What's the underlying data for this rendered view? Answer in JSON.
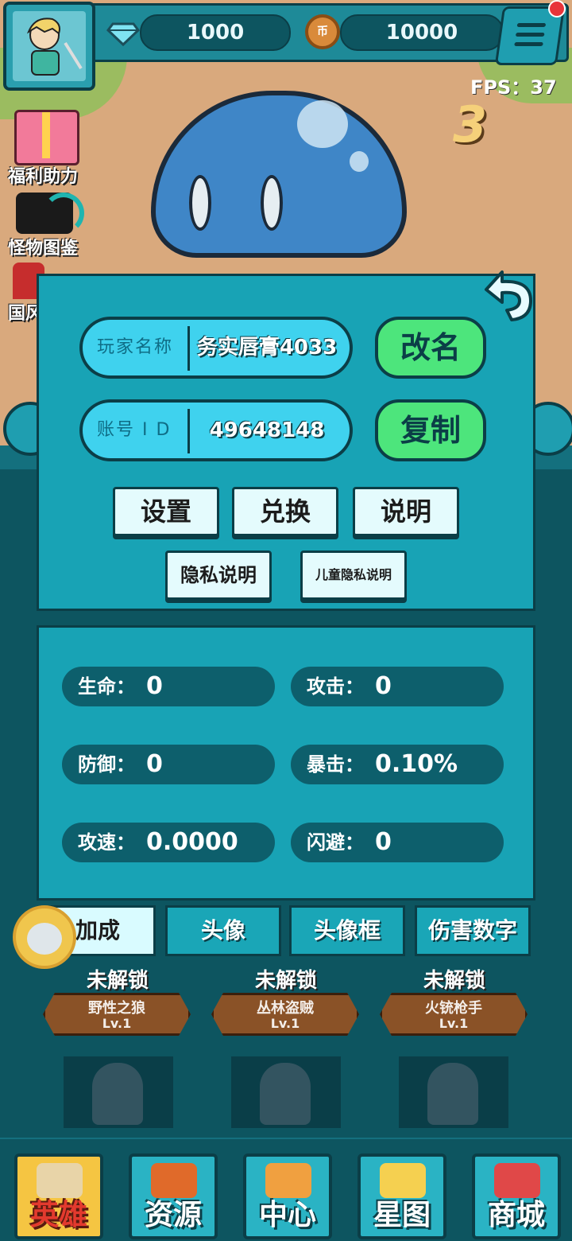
{
  "hud": {
    "gems": "1000",
    "coins": "10000",
    "coin_symbol": "币",
    "fps": "FPS：37",
    "wave_number": "3"
  },
  "side_menu": [
    {
      "label": "福利助力"
    },
    {
      "label": "怪物图鉴"
    },
    {
      "label": "国风"
    }
  ],
  "profile_panel": {
    "player_name_label": "玩家名称",
    "player_name": "务实唇膏4033",
    "rename_button": "改名",
    "account_id_label": "账号 I D",
    "account_id": "49648148",
    "copy_button": "复制",
    "buttons": [
      "设置",
      "兑换",
      "说明"
    ],
    "privacy_button": "隐私说明",
    "child_privacy_button": "儿童隐私说明"
  },
  "stats": [
    {
      "label": "生命：",
      "value": "0"
    },
    {
      "label": "攻击：",
      "value": "0"
    },
    {
      "label": "防御：",
      "value": "0"
    },
    {
      "label": "暴击：",
      "value": "0.10%"
    },
    {
      "label": "攻速：",
      "value": "0.0000"
    },
    {
      "label": "闪避：",
      "value": "0"
    }
  ],
  "tabs": [
    {
      "label": "加成",
      "active": true
    },
    {
      "label": "头像",
      "active": false
    },
    {
      "label": "头像框",
      "active": false
    },
    {
      "label": "伤害数字",
      "active": false
    }
  ],
  "heroes": [
    {
      "status": "未解锁",
      "name": "野性之狼",
      "level": "Lv.1"
    },
    {
      "status": "未解锁",
      "name": "丛林盗贼",
      "level": "Lv.1"
    },
    {
      "status": "未解锁",
      "name": "火铳枪手",
      "level": "Lv.1"
    }
  ],
  "bottom_nav": [
    {
      "label": "英雄",
      "icon": "scroll-icon",
      "active": true,
      "color": "#e8d4a8"
    },
    {
      "label": "资源",
      "icon": "crate-icon",
      "active": false,
      "color": "#e06a2a"
    },
    {
      "label": "中心",
      "icon": "sign-icon",
      "active": false,
      "color": "#f0a040"
    },
    {
      "label": "星图",
      "icon": "star-icon",
      "active": false,
      "color": "#f5d050"
    },
    {
      "label": "商城",
      "icon": "shop-icon",
      "active": false,
      "color": "#e04848"
    }
  ]
}
